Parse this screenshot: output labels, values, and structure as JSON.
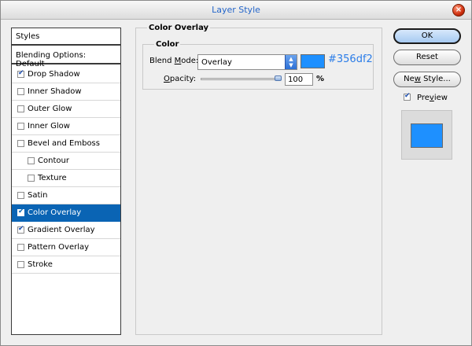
{
  "window": {
    "title": "Layer Style",
    "close_label": "×"
  },
  "styles_panel": {
    "header": "Styles",
    "blending_options": "Blending Options: Default",
    "items": [
      {
        "label": "Drop Shadow",
        "checked": true,
        "indent": false,
        "selected": false
      },
      {
        "label": "Inner Shadow",
        "checked": false,
        "indent": false,
        "selected": false
      },
      {
        "label": "Outer Glow",
        "checked": false,
        "indent": false,
        "selected": false
      },
      {
        "label": "Inner Glow",
        "checked": false,
        "indent": false,
        "selected": false
      },
      {
        "label": "Bevel and Emboss",
        "checked": false,
        "indent": false,
        "selected": false
      },
      {
        "label": "Contour",
        "checked": false,
        "indent": true,
        "selected": false
      },
      {
        "label": "Texture",
        "checked": false,
        "indent": true,
        "selected": false
      },
      {
        "label": "Satin",
        "checked": false,
        "indent": false,
        "selected": false
      },
      {
        "label": "Color Overlay",
        "checked": true,
        "indent": false,
        "selected": true
      },
      {
        "label": "Gradient Overlay",
        "checked": true,
        "indent": false,
        "selected": false
      },
      {
        "label": "Pattern Overlay",
        "checked": false,
        "indent": false,
        "selected": false
      },
      {
        "label": "Stroke",
        "checked": false,
        "indent": false,
        "selected": false
      }
    ]
  },
  "color_overlay": {
    "group_title": "Color Overlay",
    "subgroup_title": "Color",
    "blend_mode_label_pre": "Blend ",
    "blend_mode_label_u": "M",
    "blend_mode_label_post": "ode:",
    "blend_mode_value": "Overlay",
    "color_hex": "#356df2",
    "swatch_color": "#1e90ff",
    "opacity_label_u": "O",
    "opacity_label_post": "pacity:",
    "opacity_value": "100",
    "opacity_unit": "%"
  },
  "buttons": {
    "ok": "OK",
    "reset": "Reset",
    "new_style_pre": "Ne",
    "new_style_u": "w",
    "new_style_post": " Style...",
    "preview_label_pre": "Pre",
    "preview_label_u": "v",
    "preview_label_post": "iew",
    "preview_checked": true
  }
}
